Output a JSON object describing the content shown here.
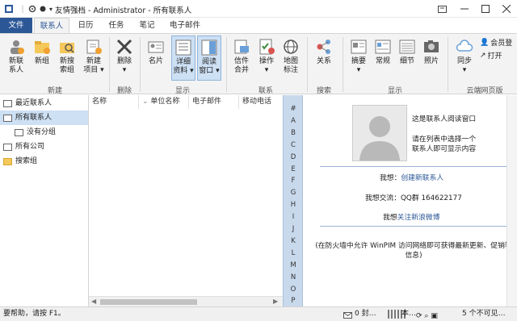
{
  "titlebar": {
    "title": "友情强档 - Administrator - 所有联系人"
  },
  "tabs": [
    "文件",
    "联系人",
    "日历",
    "任务",
    "笔记",
    "电子邮件"
  ],
  "ribbon": {
    "buttons": [
      {
        "id": "new-contact",
        "label1": "新联",
        "label2": "系人"
      },
      {
        "id": "new-group",
        "label1": "新组",
        "label2": ""
      },
      {
        "id": "new-search-group",
        "label1": "新搜",
        "label2": "索组"
      },
      {
        "id": "new-item",
        "label1": "新建",
        "label2": "项目 ▾"
      },
      {
        "id": "delete",
        "label1": "删除",
        "label2": "▾"
      },
      {
        "id": "business-card",
        "label1": "名片",
        "label2": ""
      },
      {
        "id": "detail",
        "label1": "详细",
        "label2": "资料 ▾"
      },
      {
        "id": "reading-window",
        "label1": "阅读",
        "label2": "窗口 ▾"
      },
      {
        "id": "mail-merge",
        "label1": "信件",
        "label2": "合并"
      },
      {
        "id": "action",
        "label1": "操作",
        "label2": "▾"
      },
      {
        "id": "map",
        "label1": "地图",
        "label2": "标注"
      },
      {
        "id": "relation",
        "label1": "关系",
        "label2": ""
      },
      {
        "id": "summary",
        "label1": "摘要",
        "label2": "▾"
      },
      {
        "id": "normal",
        "label1": "常规",
        "label2": ""
      },
      {
        "id": "detail2",
        "label1": "细节",
        "label2": ""
      },
      {
        "id": "photo",
        "label1": "照片",
        "label2": ""
      },
      {
        "id": "sync",
        "label1": "同步",
        "label2": "▾"
      }
    ],
    "small": {
      "member": "会员登",
      "open": "打开"
    },
    "groups": [
      "新建",
      "删除",
      "显示",
      "联系",
      "搜索",
      "显示",
      "云端网页版"
    ]
  },
  "nav": {
    "items": [
      "最近联系人",
      "所有联系人",
      "没有分组",
      "所有公司",
      "搜索组"
    ]
  },
  "columns": [
    "名称",
    "单位名称",
    "电子邮件",
    "移动电话"
  ],
  "alphabet": [
    "#",
    "A",
    "B",
    "C",
    "D",
    "E",
    "F",
    "G",
    "H",
    "I",
    "J",
    "K",
    "L",
    "M",
    "N",
    "O",
    "P"
  ],
  "reading": {
    "line1": "这是联系人阅读窗口",
    "line2": "请在列表中选择一个",
    "line3": "联系人即可显示内容",
    "want_label": "我想：",
    "create_link": "创建新联系人",
    "chat_label": "我想交流：",
    "qq": "QQ群 164622177",
    "follow_label": "我想",
    "follow_link": "关注新浪微博",
    "notice": "(在防火墙中允许 WinPIM 访问网络即可获得最新更新、促销等信息)"
  },
  "status": {
    "left": "要帮助，请按 F1。",
    "mid": "0 封…",
    "r1": "本…",
    "r2": "5 个不可见…"
  },
  "colors": {
    "accent": "#2b5797",
    "alpha_bg": "#c9d9ec"
  }
}
